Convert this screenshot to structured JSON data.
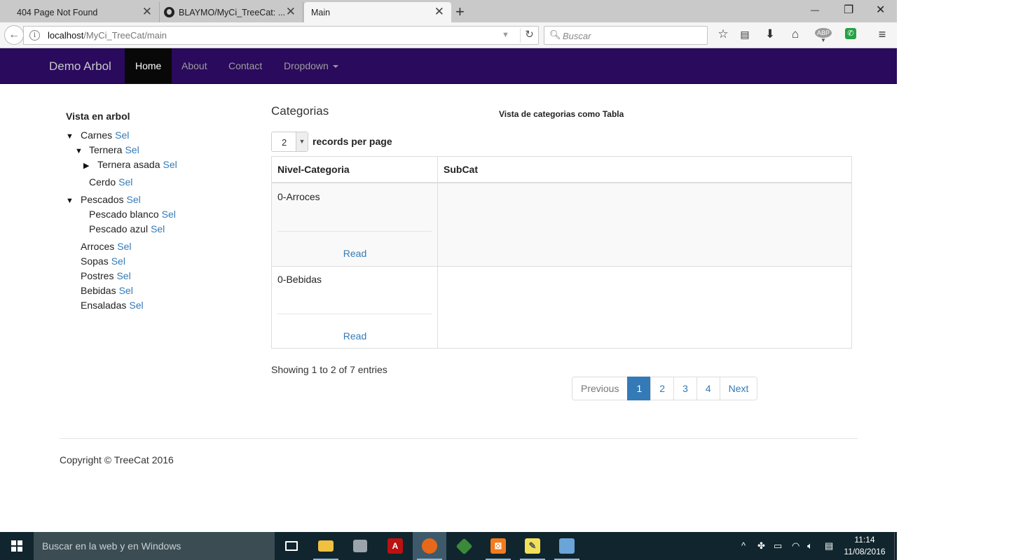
{
  "browser": {
    "tabs": [
      {
        "title": "404 Page Not Found",
        "active": false
      },
      {
        "title": "BLAYMO/MyCi_TreeCat: ...",
        "active": false
      },
      {
        "title": "Main",
        "active": true
      }
    ],
    "new_tab_symbol": "+",
    "url_host": "localhost",
    "url_path": "/MyCi_TreeCat/main",
    "search_placeholder": "Buscar",
    "window_controls": {
      "minimize": "—",
      "restore": "❐",
      "close": "✕"
    },
    "toolbar_icons": [
      "star-icon",
      "reading-list-icon",
      "download-icon",
      "home-icon",
      "adblock-icon",
      "whatsapp-icon",
      "menu-icon"
    ]
  },
  "site_nav": {
    "brand": "Demo Arbol",
    "items": [
      "Home",
      "About",
      "Contact",
      "Dropdown"
    ],
    "active": "Home"
  },
  "tree": {
    "title": "Vista en arbol",
    "sel_label": "Sel",
    "nodes": [
      {
        "label": "Carnes",
        "toggle": "▼"
      },
      {
        "label": "Ternera",
        "toggle": "▼"
      },
      {
        "label": "Ternera asada",
        "toggle": "▶"
      },
      {
        "label": "Cerdo",
        "toggle": ""
      },
      {
        "label": "Pescados",
        "toggle": "▼"
      },
      {
        "label": "Pescado blanco",
        "toggle": ""
      },
      {
        "label": "Pescado azul",
        "toggle": ""
      },
      {
        "label": "Arroces",
        "toggle": ""
      },
      {
        "label": "Sopas",
        "toggle": ""
      },
      {
        "label": "Postres",
        "toggle": ""
      },
      {
        "label": "Bebidas",
        "toggle": ""
      },
      {
        "label": "Ensaladas",
        "toggle": ""
      }
    ]
  },
  "main": {
    "title": "Categorias",
    "caption": "Vista de categorias como Tabla",
    "per_page_value": "2",
    "per_page_label": "records per page",
    "columns": [
      "Nivel-Categoria",
      "SubCat"
    ],
    "rows": [
      {
        "name": "0-Arroces",
        "action": "Read",
        "subcat": ""
      },
      {
        "name": "0-Bebidas",
        "action": "Read",
        "subcat": ""
      }
    ],
    "entries_info": "Showing 1 to 2 of 7 entries",
    "pagination": [
      "Previous",
      "1",
      "2",
      "3",
      "4",
      "Next"
    ],
    "current_page": "1"
  },
  "footer": {
    "text": "Copyright © TreeCat 2016"
  },
  "taskbar": {
    "search_placeholder": "Buscar en la web y en Windows",
    "apps": [
      "task-view-icon",
      "file-explorer-icon",
      "store-icon",
      "acrobat-icon",
      "firefox-icon",
      "git-icon",
      "xampp-icon",
      "notes-icon",
      "virtualbox-icon"
    ],
    "time": "11:14",
    "date": "11/08/2016"
  },
  "colors": {
    "navbar_bg": "#2a0a5c",
    "link": "#337ab7",
    "taskbar_bg": "#10252d"
  }
}
